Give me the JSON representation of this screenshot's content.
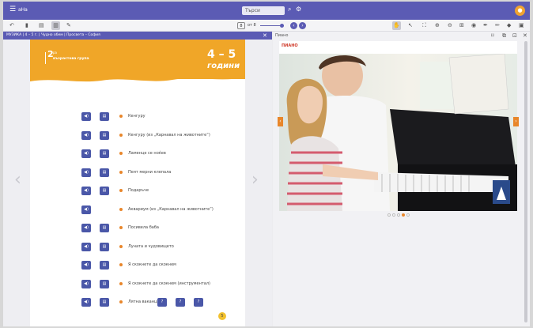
{
  "topbar": {
    "search_placeholder": "Търси",
    "search_icon": "search-icon",
    "settings_icon": "gear-icon",
    "avatar_letter": "●"
  },
  "toolbar": {
    "page_current": "8",
    "page_total": "от 8",
    "left_icons": [
      "undo-icon",
      "trash-icon",
      "single-page-icon",
      "double-page-icon",
      "edit-icon"
    ],
    "right_icons": [
      "hand-icon",
      "pointer-icon",
      "fit-icon",
      "zoom-in-icon",
      "zoom-out-icon",
      "fullscreen-icon",
      "eye-icon",
      "pen-icon",
      "pencil-icon",
      "eraser-icon",
      "save-icon"
    ]
  },
  "left_panel": {
    "header_title": "МУЗИКА | 4 – 5 г. | Чудно обем | Просвета – София",
    "page": {
      "grade_number": "2",
      "grade_sup": "ра",
      "group_name": "възрастова група",
      "age_range": "4 – 5",
      "age_label": "години",
      "page_number": "5",
      "rows": [
        {
          "label": "Кенгуру",
          "has_second": true
        },
        {
          "label": "Кенгуру (из „Карнавал на животните“)",
          "has_second": true
        },
        {
          "label": "Ламенце се ноќев",
          "has_second": true
        },
        {
          "label": "Пеят мерни клепала",
          "has_second": true
        },
        {
          "label": "Подаръче",
          "has_second": true
        },
        {
          "label": "Аквариум (из „Карнавал на животните“)",
          "has_second": false
        },
        {
          "label": "Посивела баба",
          "has_second": true
        },
        {
          "label": "Луната и чудовището",
          "has_second": true
        },
        {
          "label": "Я скокнете да скокнем",
          "has_second": true
        },
        {
          "label": "Я скокнете да скокнем (инструментал)",
          "has_second": true
        },
        {
          "label": "Лятна ваканция",
          "has_second": true
        }
      ]
    }
  },
  "right_panel": {
    "label": "Пиано",
    "photo_label": "ПИАНО",
    "carousel_dots": 5,
    "active_dot": 4
  }
}
